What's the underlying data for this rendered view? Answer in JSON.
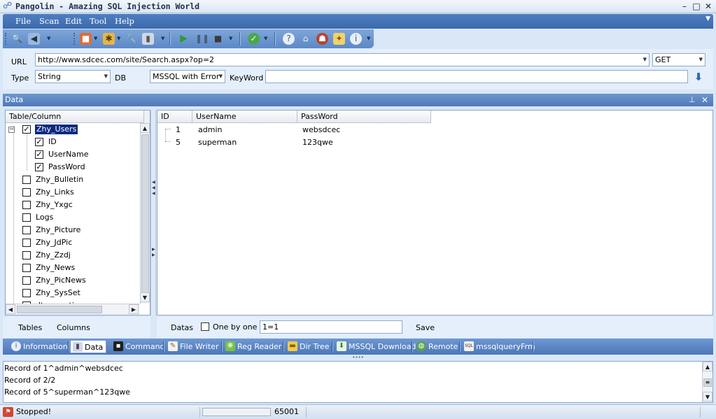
{
  "window": {
    "title": "Pangolin - Amazing SQL Injection World",
    "controls": {
      "minimize": "–",
      "maximize": "□",
      "close": "✕"
    }
  },
  "menu": [
    "File",
    "Scan",
    "Edit",
    "Tool",
    "Help"
  ],
  "url_panel": {
    "url_label": "URL",
    "url_value": "http://www.sdcec.com/site/Search.aspx?op=2",
    "method": "GET",
    "type_label": "Type",
    "type_value": "String",
    "db_label": "DB",
    "db_value": "MSSQL with Error",
    "keyword_label": "KeyWord",
    "keyword_value": ""
  },
  "data_panel": {
    "title": "Data",
    "pin": "ᵖ",
    "close": "✕"
  },
  "tree": {
    "header": "Table/Column",
    "items": [
      {
        "label": "Zhy_Users",
        "checked": true,
        "selected": true,
        "level": 0
      },
      {
        "label": "ID",
        "checked": true,
        "level": 1
      },
      {
        "label": "UserName",
        "checked": true,
        "level": 1
      },
      {
        "label": "PassWord",
        "checked": true,
        "level": 1
      },
      {
        "label": "Zhy_Bulletin",
        "checked": false,
        "level": 0
      },
      {
        "label": "Zhy_Links",
        "checked": false,
        "level": 0
      },
      {
        "label": "Zhy_Yxgc",
        "checked": false,
        "level": 0
      },
      {
        "label": "Logs",
        "checked": false,
        "level": 0
      },
      {
        "label": "Zhy_Picture",
        "checked": false,
        "level": 0
      },
      {
        "label": "Zhy_JdPic",
        "checked": false,
        "level": 0
      },
      {
        "label": "Zhy_Zzdj",
        "checked": false,
        "level": 0
      },
      {
        "label": "Zhy_News",
        "checked": false,
        "level": 0
      },
      {
        "label": "Zhy_PicNews",
        "checked": false,
        "level": 0
      },
      {
        "label": "Zhy_SysSet",
        "checked": false,
        "level": 0
      },
      {
        "label": "dtproperties",
        "checked": false,
        "level": 0
      }
    ],
    "footer": {
      "tables": "Tables",
      "columns": "Columns"
    }
  },
  "grid": {
    "columns": [
      "ID",
      "UserName",
      "PassWord"
    ],
    "rows": [
      {
        "id": "1",
        "username": "admin",
        "password": "websdcec"
      },
      {
        "id": "5",
        "username": "superman",
        "password": "123qwe"
      }
    ],
    "footer": {
      "datas": "Datas",
      "one_by_one": "One by one",
      "condition": "1=1",
      "save": "Save"
    }
  },
  "tabs": [
    {
      "label": "Information",
      "icon": "info-icon",
      "active": false
    },
    {
      "label": "Data",
      "icon": "database-icon",
      "active": true
    },
    {
      "label": "Command",
      "icon": "terminal-icon",
      "active": false
    },
    {
      "label": "File Writer",
      "icon": "pencil-icon",
      "active": false
    },
    {
      "label": "Reg Reader",
      "icon": "registry-icon",
      "active": false
    },
    {
      "label": "Dir Tree",
      "icon": "folder-icon",
      "active": false
    },
    {
      "label": "MSSQL Download",
      "icon": "download-icon",
      "active": false
    },
    {
      "label": "Remote",
      "icon": "globe-icon",
      "active": false
    },
    {
      "label": "mssqlqueryFrm",
      "icon": "sql-icon",
      "active": false
    }
  ],
  "log": [
    "Record of 1^admin^websdcec",
    "Record of 2/2",
    "Record of 5^superman^123qwe"
  ],
  "status": {
    "state": "Stopped!",
    "progress": 0,
    "count": "65001"
  }
}
